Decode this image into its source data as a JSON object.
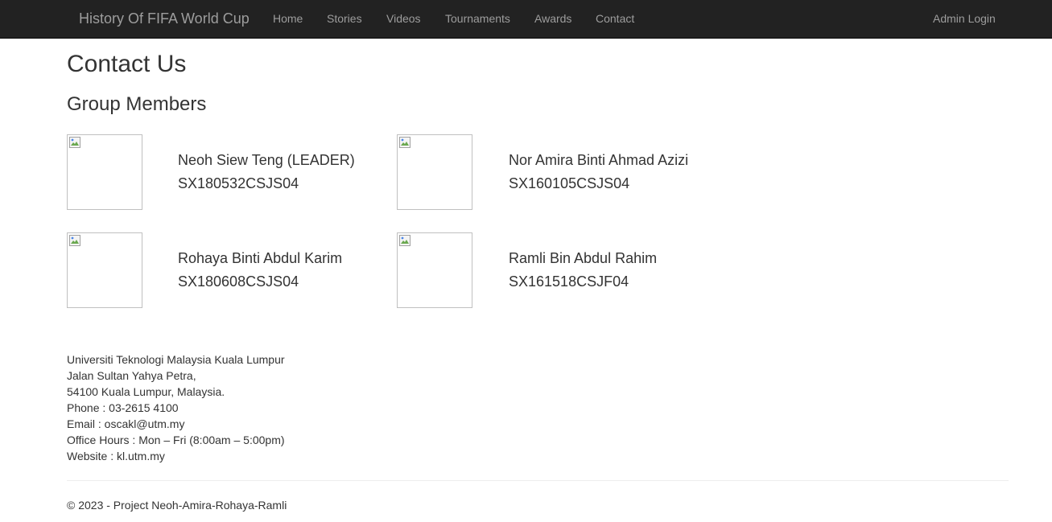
{
  "navbar": {
    "brand": "History Of FIFA World Cup",
    "links": [
      "Home",
      "Stories",
      "Videos",
      "Tournaments",
      "Awards",
      "Contact"
    ],
    "admin_login": "Admin Login"
  },
  "page": {
    "title": "Contact Us",
    "section_title": "Group Members"
  },
  "members": [
    {
      "name": "Neoh Siew Teng (LEADER)",
      "id": "SX180532CSJS04"
    },
    {
      "name": "Nor Amira Binti Ahmad Azizi",
      "id": "SX160105CSJS04"
    },
    {
      "name": "Rohaya Binti Abdul Karim",
      "id": "SX180608CSJS04"
    },
    {
      "name": "Ramli Bin Abdul Rahim",
      "id": "SX161518CSJF04"
    }
  ],
  "contact": {
    "lines": [
      "Universiti Teknologi Malaysia Kuala Lumpur",
      "Jalan Sultan Yahya Petra,",
      "54100 Kuala Lumpur, Malaysia.",
      "Phone : 03-2615 4100",
      "Email : oscakl@utm.my",
      "Office Hours : Mon – Fri (8:00am – 5:00pm)",
      "Website : kl.utm.my"
    ]
  },
  "footer": {
    "text": "© 2023 - Project Neoh-Amira-Rohaya-Ramli"
  }
}
